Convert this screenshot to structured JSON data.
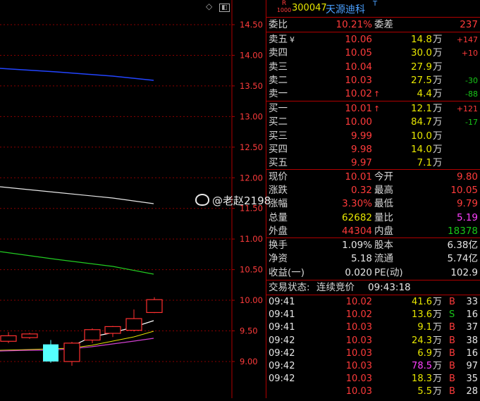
{
  "header": {
    "badge_top": "R",
    "badge_bottom": "1000",
    "code": "300047",
    "name": "天源迪科",
    "suffix": "T"
  },
  "chart": {
    "price_ticks": [
      "14.50",
      "14.00",
      "13.50",
      "13.00",
      "12.50",
      "12.00",
      "11.50",
      "11.00",
      "10.50",
      "10.00",
      "9.50",
      "9.00"
    ],
    "candles": [
      {
        "open": 9.33,
        "close": 9.42,
        "high": 9.48,
        "low": 9.3,
        "color": "red"
      },
      {
        "open": 9.39,
        "close": 9.45,
        "high": 9.47,
        "low": 9.37,
        "color": "red"
      },
      {
        "open": 9.0,
        "close": 9.28,
        "high": 9.35,
        "low": 8.98,
        "color": "cyan"
      },
      {
        "open": 9.0,
        "close": 9.3,
        "high": 9.32,
        "low": 8.93,
        "color": "red"
      },
      {
        "open": 9.35,
        "close": 9.52,
        "high": 9.54,
        "low": 9.3,
        "color": "red"
      },
      {
        "open": 9.46,
        "close": 9.57,
        "high": 9.58,
        "low": 9.4,
        "color": "red"
      },
      {
        "open": 9.51,
        "close": 9.7,
        "high": 9.85,
        "low": 9.49,
        "color": "red"
      },
      {
        "open": 9.8,
        "close": 10.01,
        "high": 10.05,
        "low": 9.79,
        "color": "red"
      }
    ]
  },
  "ratio": {
    "label": "委比",
    "value": "10.21%",
    "diff_label": "委差",
    "diff": "237"
  },
  "sell": [
    {
      "label": "卖五",
      "mark": "¥",
      "price": "10.06",
      "vol": "14.8",
      "unit": "万",
      "chg": "+147"
    },
    {
      "label": "卖四",
      "mark": "",
      "price": "10.05",
      "vol": "30.0",
      "unit": "万",
      "chg": "+10"
    },
    {
      "label": "卖三",
      "mark": "",
      "price": "10.04",
      "vol": "27.9",
      "unit": "万",
      "chg": ""
    },
    {
      "label": "卖二",
      "mark": "",
      "price": "10.03",
      "vol": "27.5",
      "unit": "万",
      "chg": "-30"
    },
    {
      "label": "卖一",
      "mark": "",
      "price": "10.02",
      "arrow": "↑",
      "vol": "4.4",
      "unit": "万",
      "chg": "-88"
    }
  ],
  "buy": [
    {
      "label": "买一",
      "price": "10.01",
      "arrow": "↑",
      "vol": "12.1",
      "unit": "万",
      "chg": "+121"
    },
    {
      "label": "买二",
      "price": "10.00",
      "arrow": "",
      "vol": "84.7",
      "unit": "万",
      "chg": "-17"
    },
    {
      "label": "买三",
      "price": "9.99",
      "arrow": "",
      "vol": "10.0",
      "unit": "万",
      "chg": ""
    },
    {
      "label": "买四",
      "price": "9.98",
      "arrow": "",
      "vol": "14.0",
      "unit": "万",
      "chg": ""
    },
    {
      "label": "买五",
      "price": "9.97",
      "arrow": "",
      "vol": "7.1",
      "unit": "万",
      "chg": ""
    }
  ],
  "quote": [
    {
      "l1": "现价",
      "v1": "10.01",
      "c1": "red",
      "l2": "今开",
      "v2": "9.80",
      "c2": "red"
    },
    {
      "l1": "涨跌",
      "v1": "0.32",
      "c1": "red",
      "l2": "最高",
      "v2": "10.05",
      "c2": "red"
    },
    {
      "l1": "涨幅",
      "v1": "3.30%",
      "c1": "red",
      "l2": "最低",
      "v2": "9.79",
      "c2": "red"
    },
    {
      "l1": "总量",
      "v1": "62682",
      "c1": "yellow",
      "l2": "量比",
      "v2": "5.19",
      "c2": "magenta"
    },
    {
      "l1": "外盘",
      "v1": "44304",
      "c1": "red",
      "l2": "内盘",
      "v2": "18378",
      "c2": "green"
    }
  ],
  "stats": [
    {
      "l1": "换手",
      "v1": "1.09%",
      "l2": "股本",
      "v2": "6.38亿"
    },
    {
      "l1": "净资",
      "v1": "5.18",
      "l2": "流通",
      "v2": "5.74亿"
    },
    {
      "l1": "收益(一)",
      "v1": "0.020",
      "l2": "PE(动)",
      "v2": "102.9"
    }
  ],
  "trade_status": {
    "label": "交易状态:",
    "value": "连续竞价",
    "time": "09:43:18"
  },
  "ticks": [
    {
      "time": "09:41",
      "price": "10.02",
      "vol": "41.6",
      "unit": "万",
      "vc": "yellow",
      "side": "B",
      "sc": "red",
      "n": "33"
    },
    {
      "time": "09:41",
      "price": "10.02",
      "vol": "13.6",
      "unit": "万",
      "vc": "yellow",
      "side": "S",
      "sc": "green",
      "n": "16"
    },
    {
      "time": "09:41",
      "price": "10.03",
      "vol": "9.1",
      "unit": "万",
      "vc": "yellow",
      "side": "B",
      "sc": "red",
      "n": "37"
    },
    {
      "time": "09:42",
      "price": "10.03",
      "vol": "24.3",
      "unit": "万",
      "vc": "yellow",
      "side": "B",
      "sc": "red",
      "n": "38"
    },
    {
      "time": "09:42",
      "price": "10.03",
      "vol": "6.9",
      "unit": "万",
      "vc": "yellow",
      "side": "B",
      "sc": "red",
      "n": "16"
    },
    {
      "time": "09:42",
      "price": "10.03",
      "vol": "78.5",
      "unit": "万",
      "vc": "magenta",
      "side": "B",
      "sc": "red",
      "n": "97"
    },
    {
      "time": "09:42",
      "price": "10.03",
      "vol": "18.3",
      "unit": "万",
      "vc": "yellow",
      "side": "B",
      "sc": "red",
      "n": "35"
    },
    {
      "time": "",
      "price": "10.03",
      "vol": "5.5",
      "unit": "万",
      "vc": "yellow",
      "side": "B",
      "sc": "red",
      "n": "28"
    }
  ],
  "watermark": "@老赵2198",
  "colors": {
    "red": "#ff3b3b",
    "green": "#18c818",
    "yellow": "#e6e600",
    "grid": "#8a0000",
    "ma_blue": "#2244ff",
    "ma_white": "#e6e6e6",
    "ma_green": "#22cc22",
    "ma_magenta": "#d040d0"
  }
}
